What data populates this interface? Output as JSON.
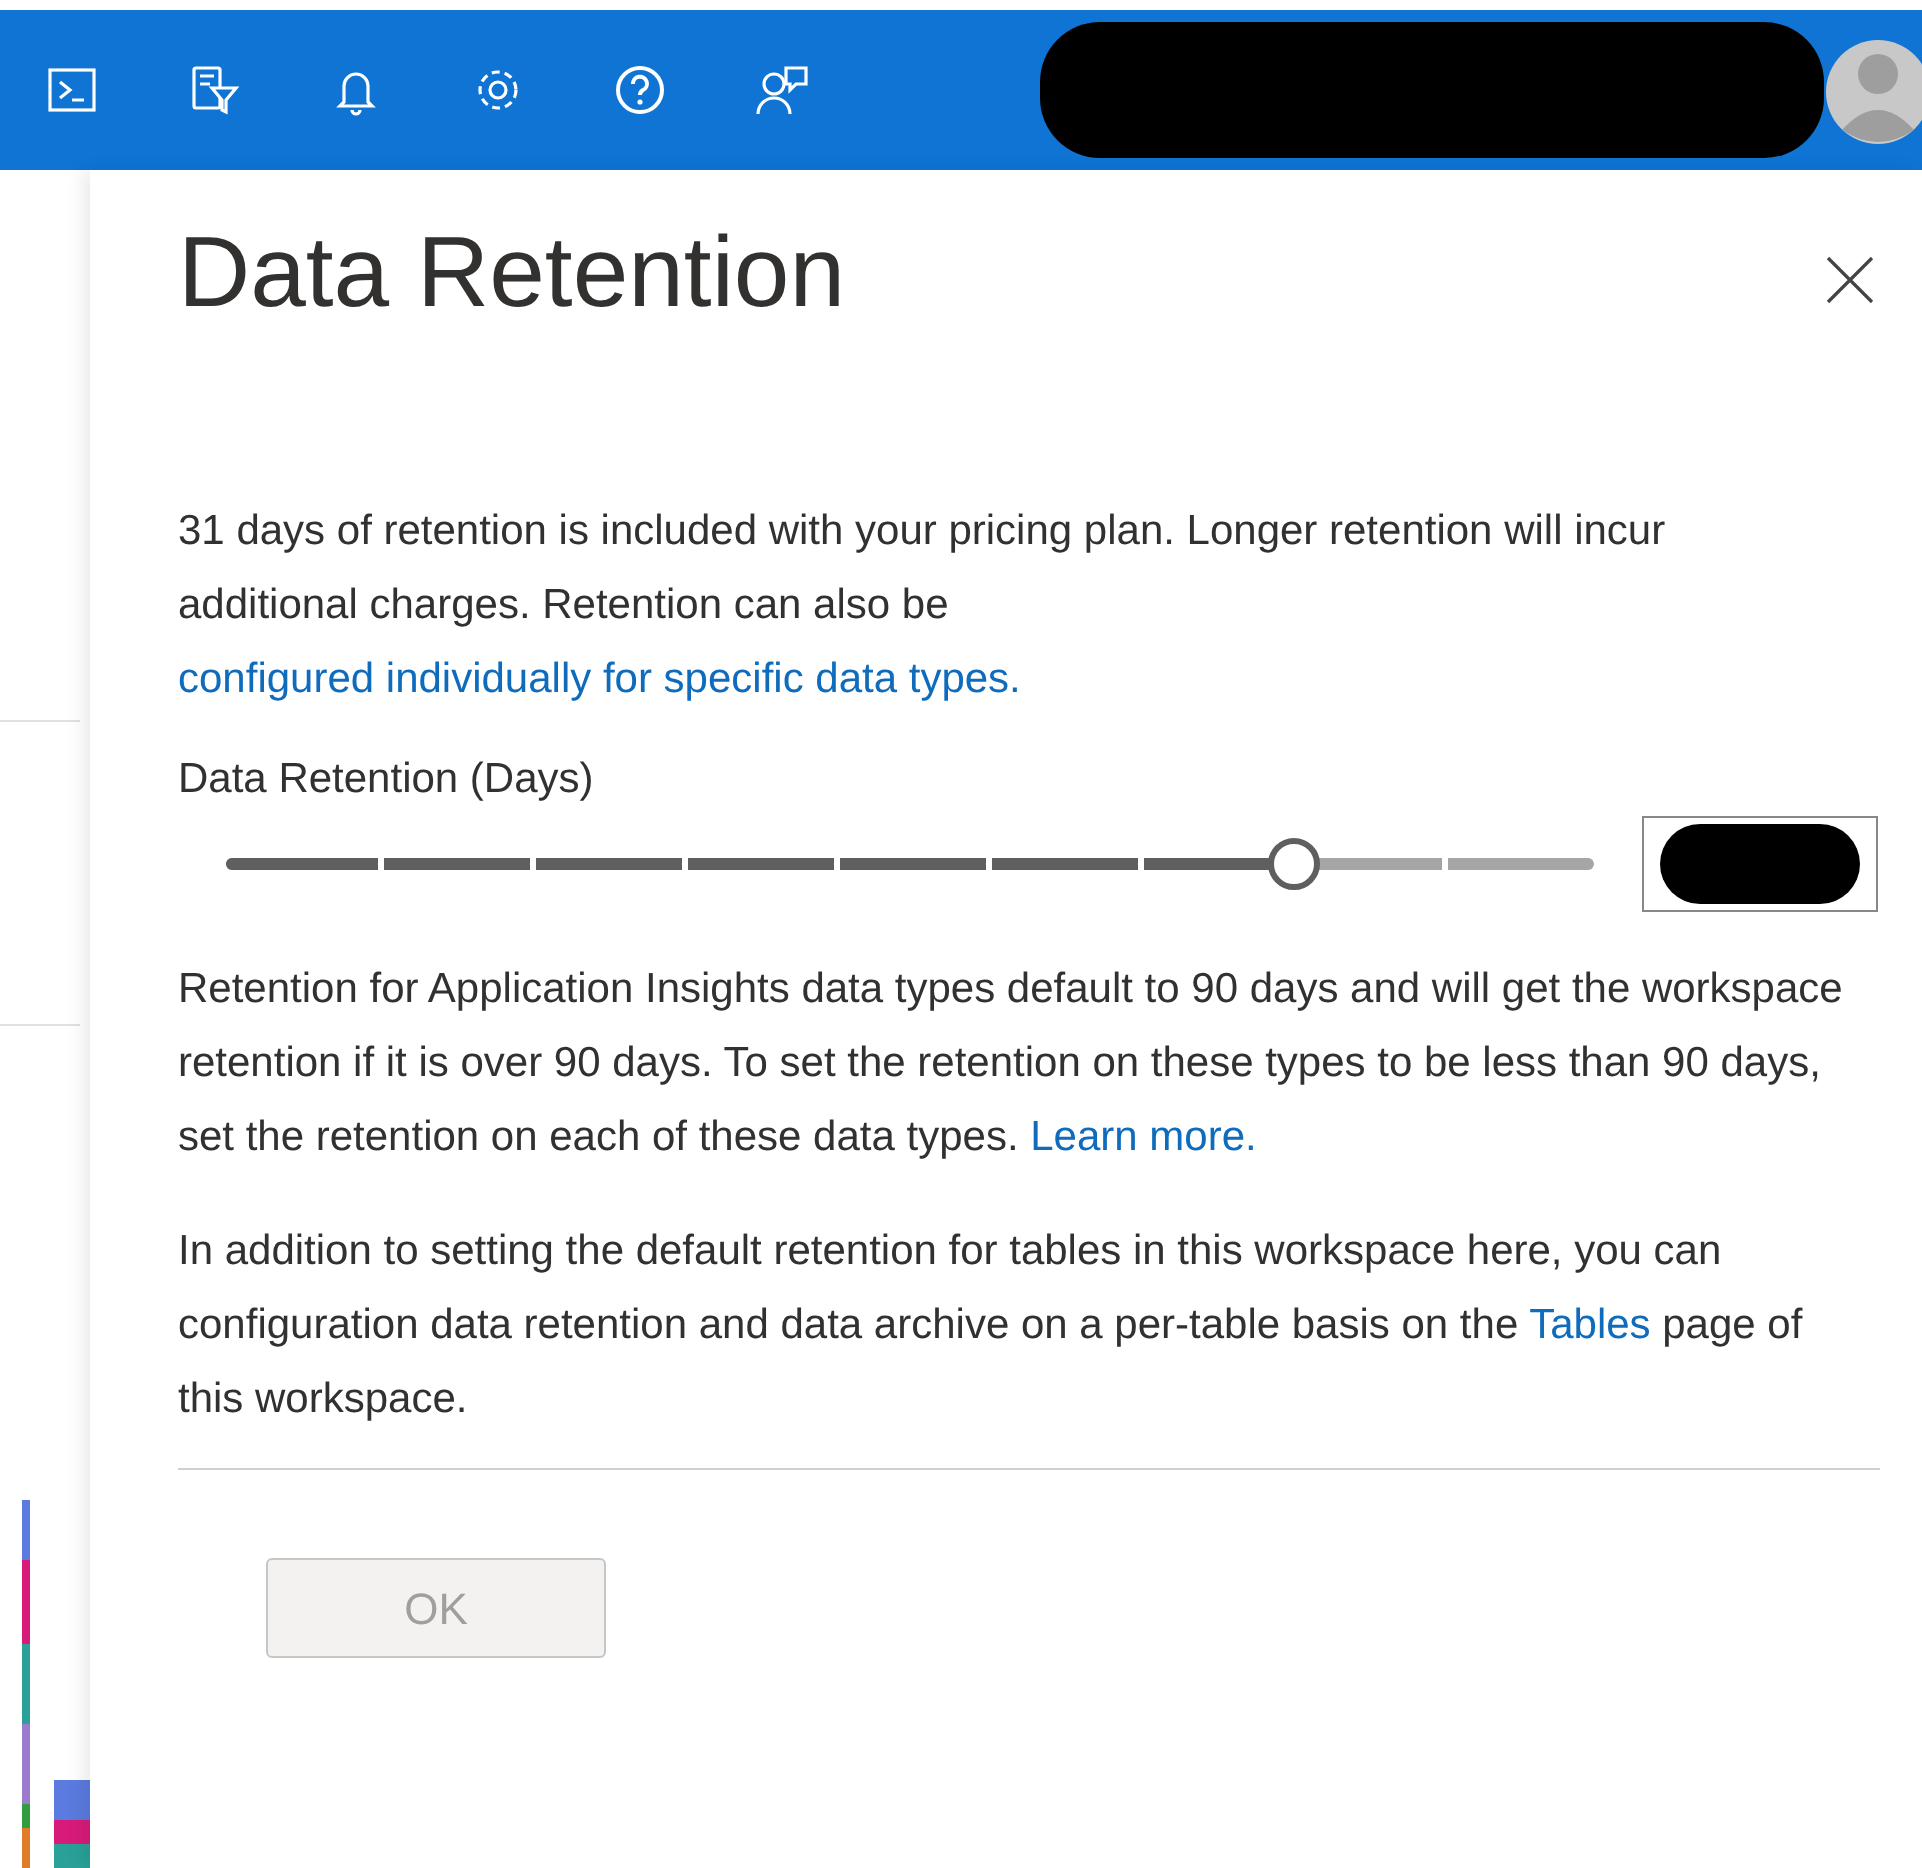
{
  "top_bar": {
    "icons": [
      {
        "kind": "terminal"
      },
      {
        "kind": "filter"
      },
      {
        "kind": "bell"
      },
      {
        "kind": "settings"
      },
      {
        "kind": "help"
      },
      {
        "kind": "feedback"
      }
    ]
  },
  "panel": {
    "title": "Data Retention",
    "intro": {
      "text": "31 days of retention is included with your pricing plan. Longer retention will incur additional charges. Retention can also be ",
      "link": "configured individually for specific data types."
    },
    "slider": {
      "label": "Data Retention (Days)",
      "level": 0.78
    },
    "note": {
      "text": "Retention for Application Insights data types default to 90 days and will get the workspace retention if it is over 90 days. To set the retention on these types to be less than 90 days, set the retention on each of these data types. ",
      "link": "Learn more."
    },
    "tables_note": {
      "before": "In addition to setting the default retention for tables in this workspace here, you can configuration data retention and data archive on a per-table basis on the ",
      "link": "Tables",
      "after": " page of this workspace."
    },
    "ok_button": {
      "label": "OK",
      "disabled": true
    }
  }
}
